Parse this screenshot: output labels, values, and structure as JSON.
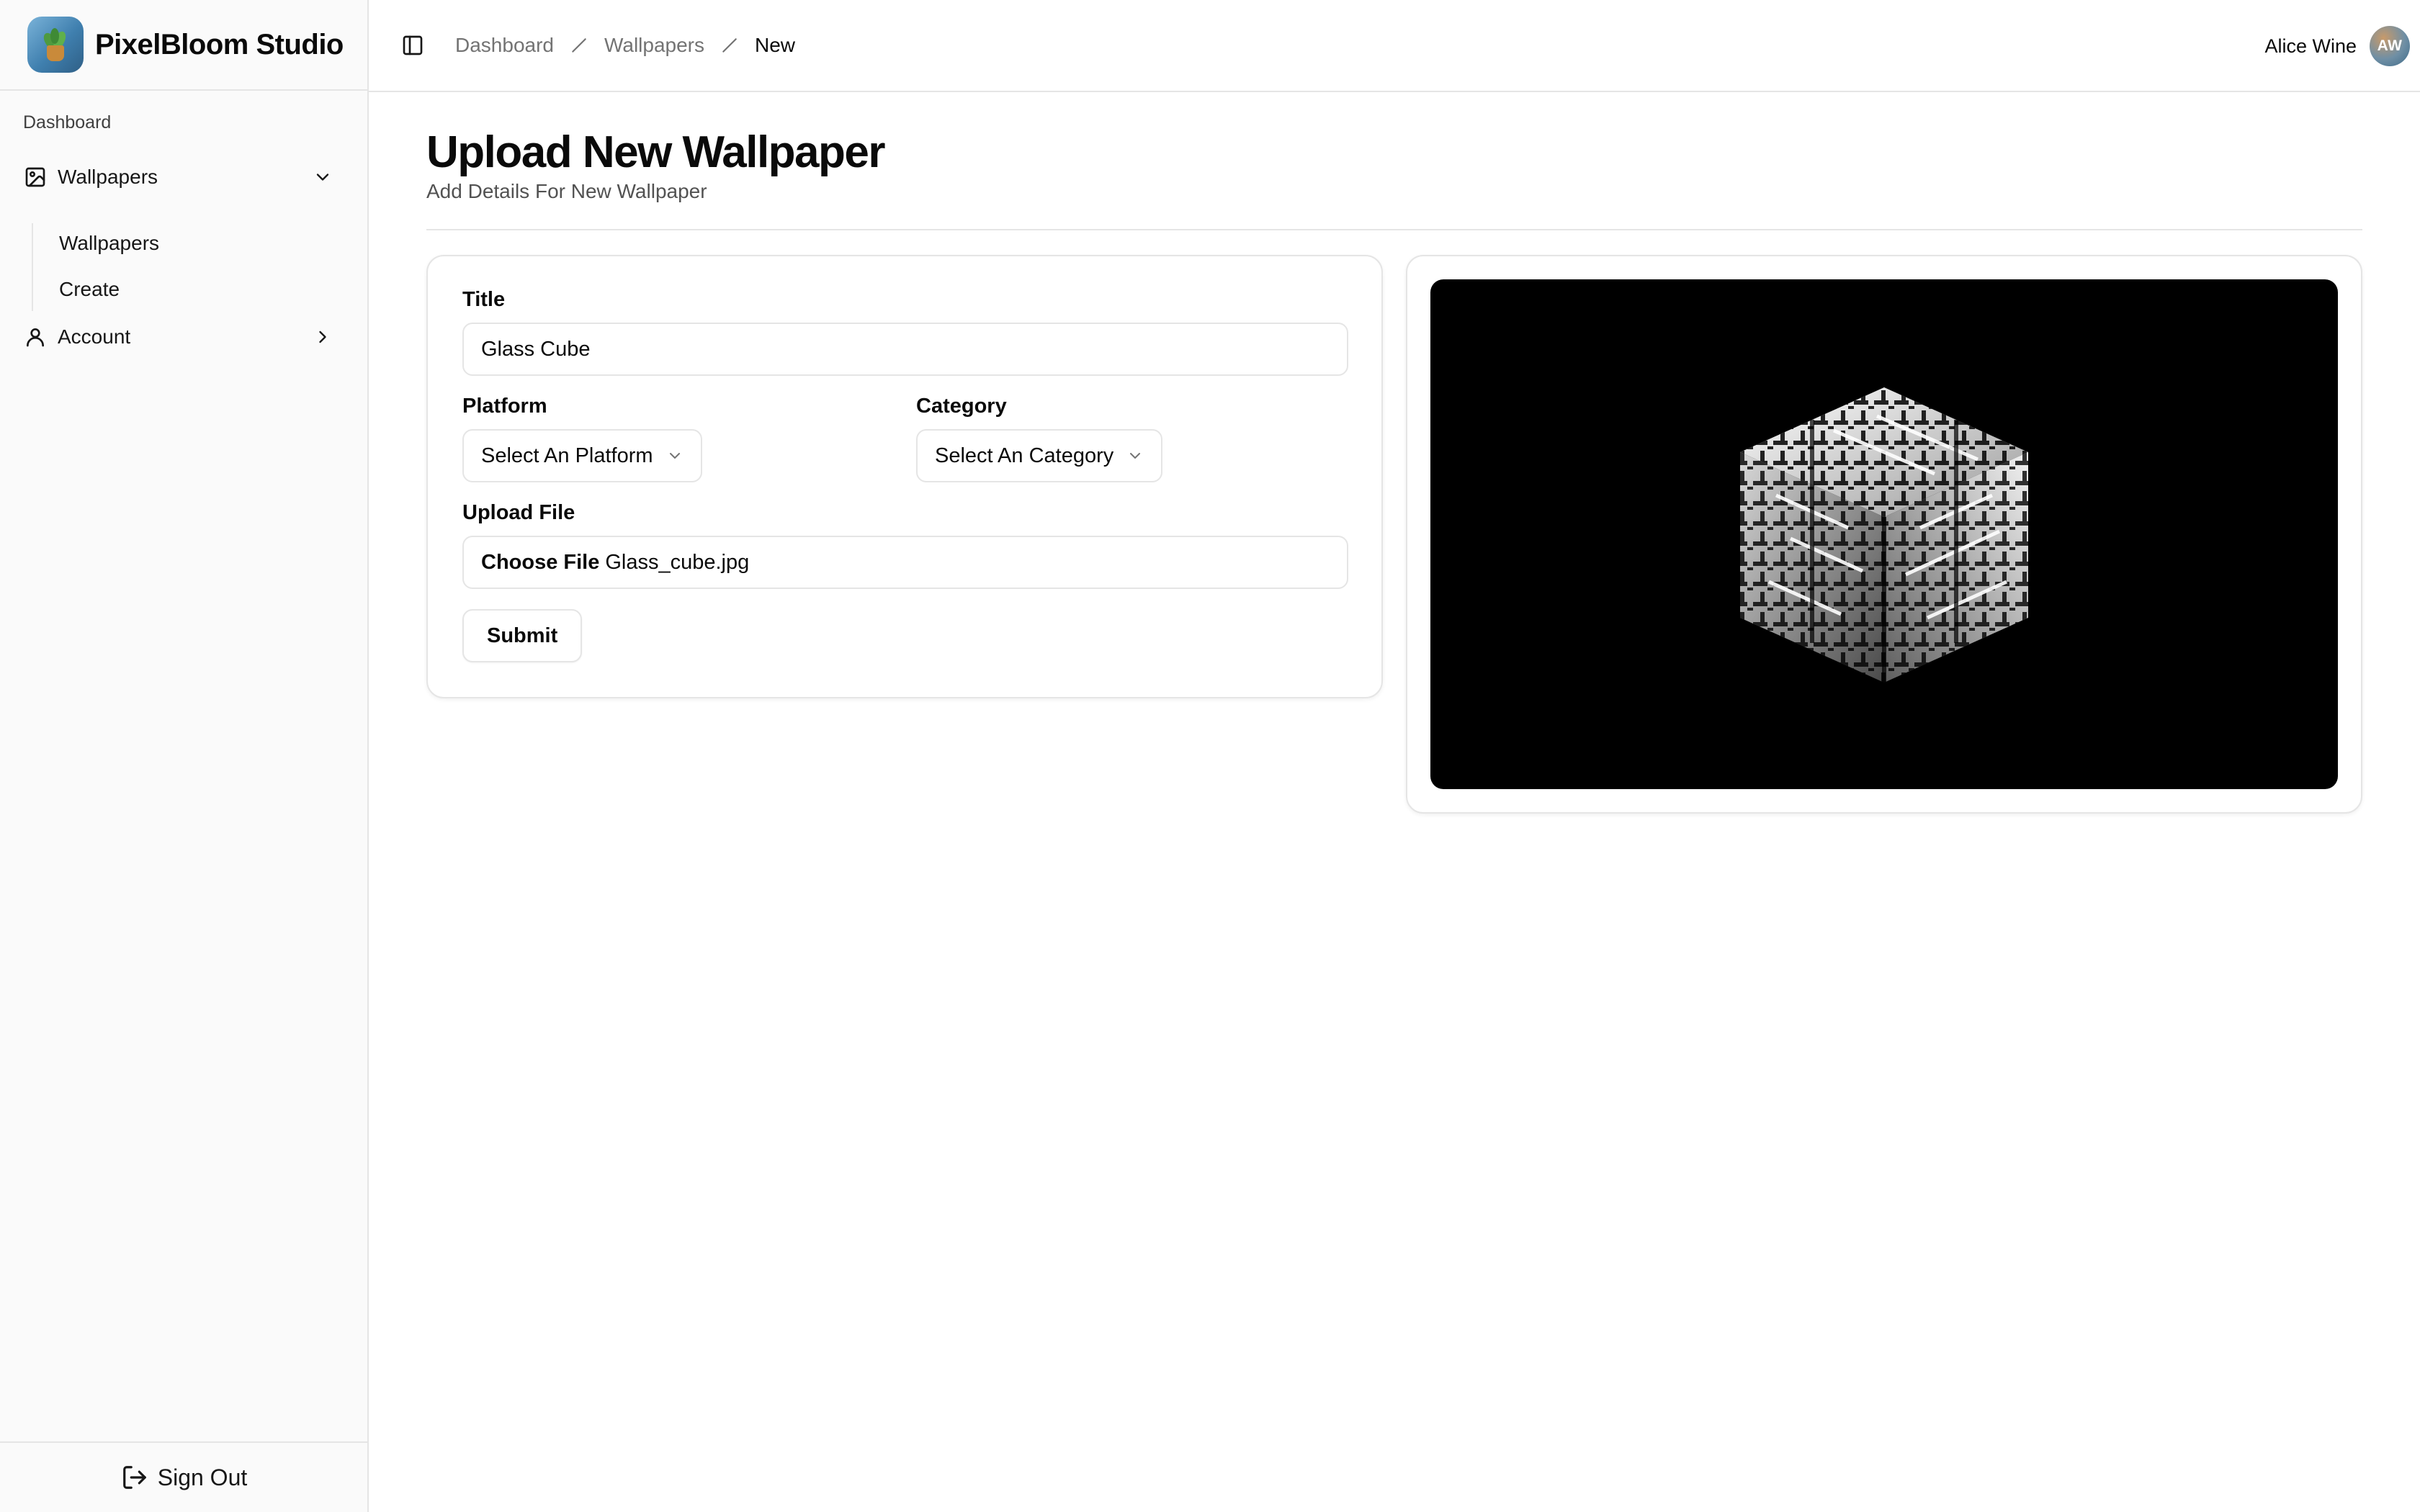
{
  "app": {
    "name": "PixelBloom Studio"
  },
  "sidebar": {
    "group_label": "Dashboard",
    "items": [
      {
        "label": "Wallpapers",
        "icon": "image-icon",
        "expanded": true,
        "children": [
          {
            "label": "Wallpapers"
          },
          {
            "label": "Create"
          }
        ]
      },
      {
        "label": "Account",
        "icon": "user-icon",
        "expanded": false
      }
    ],
    "sign_out_label": "Sign Out"
  },
  "header": {
    "breadcrumbs": [
      "Dashboard",
      "Wallpapers",
      "New"
    ],
    "user": {
      "name": "Alice Wine",
      "initials": "AW"
    }
  },
  "main": {
    "title": "Upload New Wallpaper",
    "subtitle": "Add Details For New Wallpaper",
    "form": {
      "title_label": "Title",
      "title_value": "Glass Cube",
      "platform_label": "Platform",
      "platform_value": "Select An Platform",
      "category_label": "Category",
      "category_value": "Select An Category",
      "upload_label": "Upload File",
      "file_button": "Choose File",
      "file_name": "Glass_cube.jpg",
      "submit_label": "Submit"
    },
    "preview": {
      "image": "glass-cube-wallpaper",
      "background": "#000000"
    }
  },
  "colors": {
    "sidebar_bg": "#fafafa",
    "border": "#e5e5e5",
    "text": "#0a0a0a",
    "muted_text": "#737373"
  }
}
